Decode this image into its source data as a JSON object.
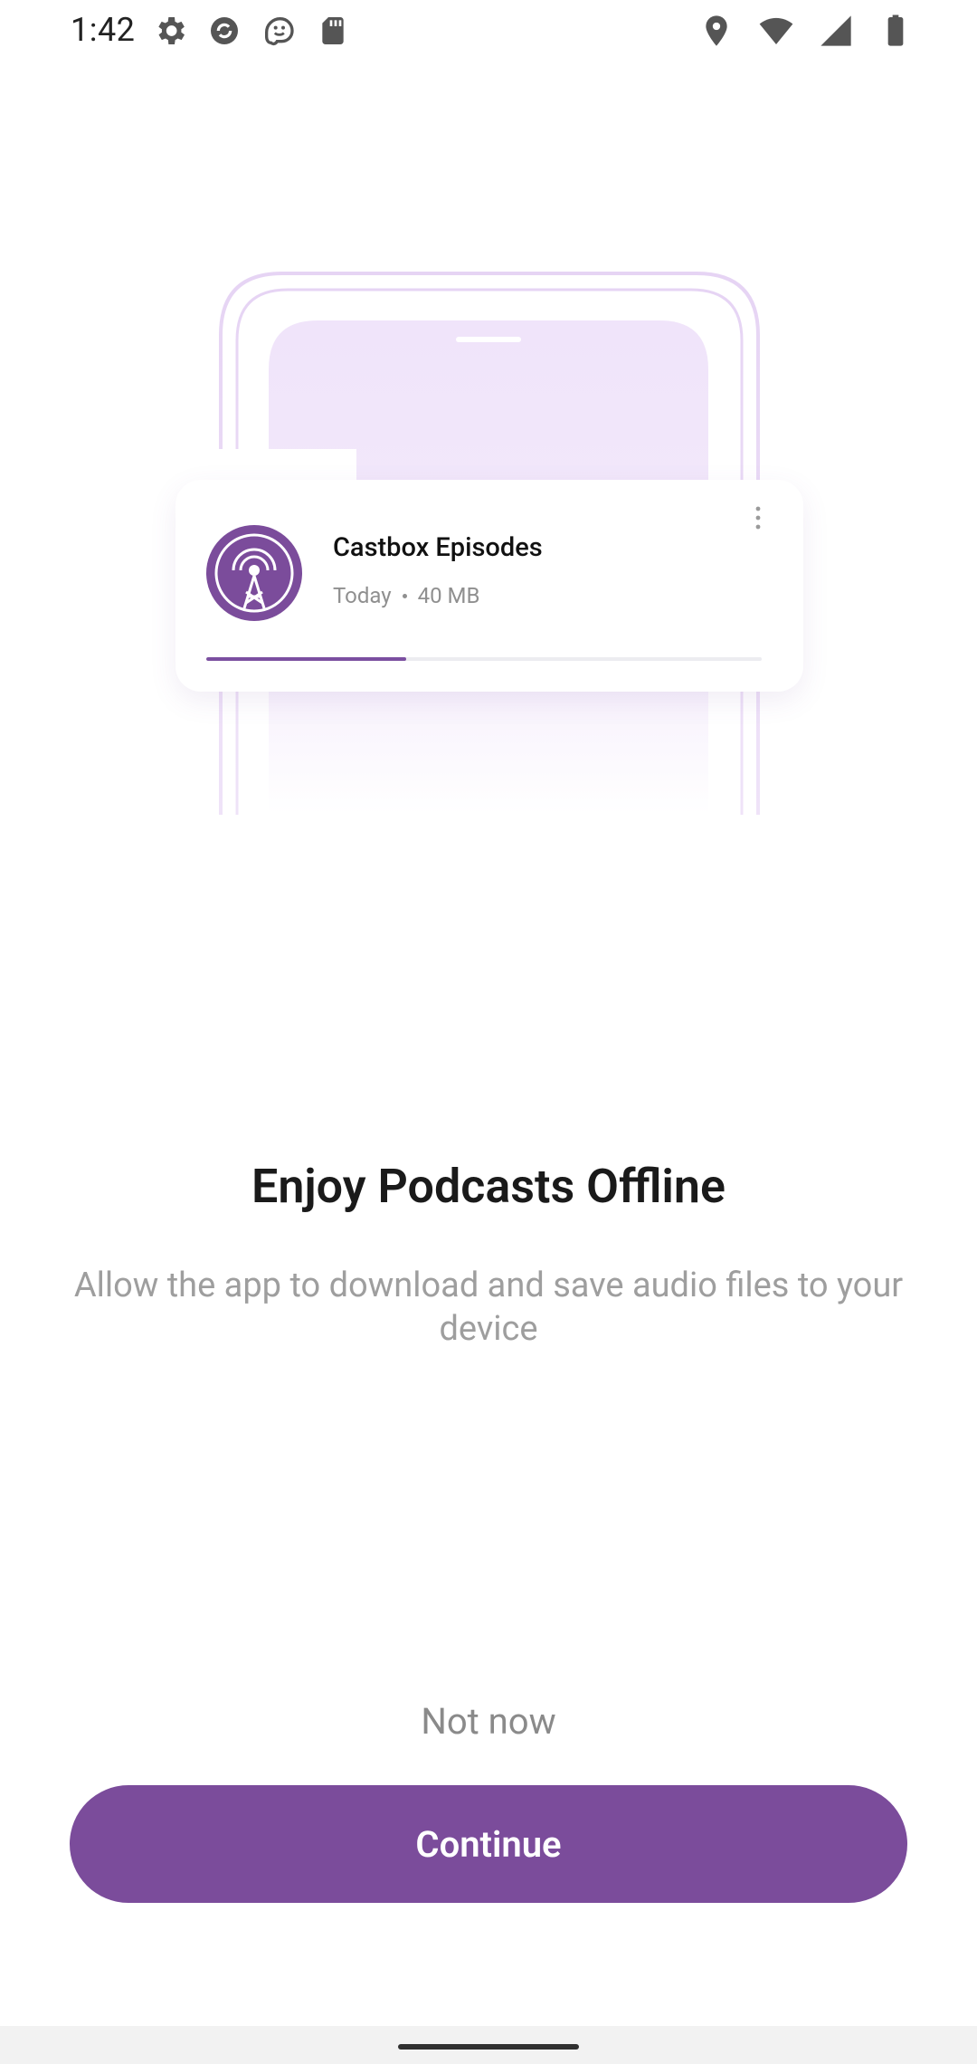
{
  "status_bar": {
    "time": "1:42",
    "left_icons": [
      "settings-icon",
      "sync-icon",
      "waze-icon",
      "sd-card-icon"
    ],
    "right_icons": [
      "location-icon",
      "wifi-icon",
      "signal-icon",
      "battery-icon"
    ]
  },
  "illustration": {
    "episode_card": {
      "title": "Castbox Episodes",
      "date": "Today",
      "size": "40 MB",
      "progress": 0.36,
      "icon": "podcast-tower-icon",
      "menu_icon": "more-vertical-icon"
    }
  },
  "content": {
    "headline": "Enjoy Podcasts Offline",
    "subtext": "Allow the app to download and save audio files to your device"
  },
  "actions": {
    "not_now_label": "Not now",
    "continue_label": "Continue"
  },
  "colors": {
    "accent": "#7b4c9b",
    "illustration_tint": "#f1e6f9"
  }
}
